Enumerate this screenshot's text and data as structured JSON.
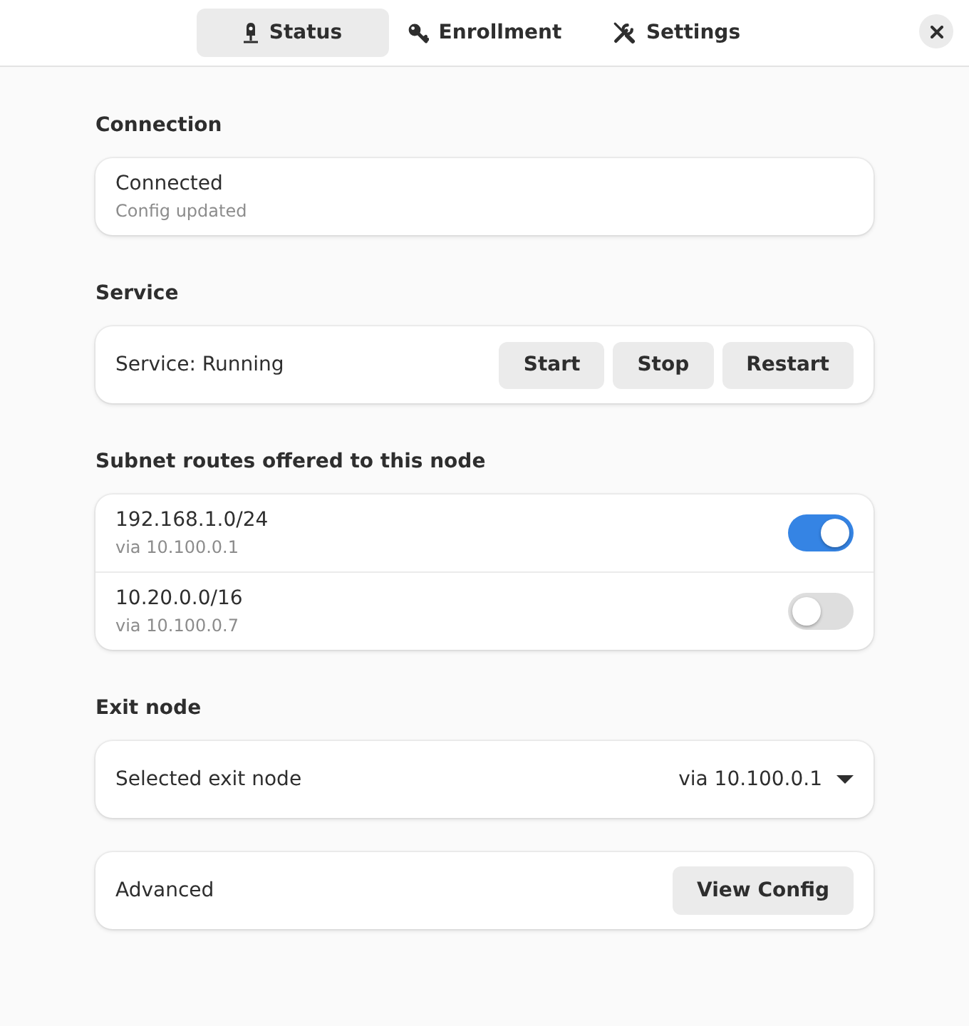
{
  "tabs": [
    {
      "label": "Status",
      "selected": true
    },
    {
      "label": "Enrollment",
      "selected": false
    },
    {
      "label": "Settings",
      "selected": false
    }
  ],
  "connection": {
    "heading": "Connection",
    "title": "Connected",
    "subtitle": "Config updated"
  },
  "service": {
    "heading": "Service",
    "label": "Service: Running",
    "buttons": [
      "Start",
      "Stop",
      "Restart"
    ]
  },
  "subnet_routes": {
    "heading": "Subnet routes offered to this node",
    "routes": [
      {
        "subnet": "192.168.1.0/24",
        "via": "via 10.100.0.1",
        "on": true
      },
      {
        "subnet": "10.20.0.0/16",
        "via": "via 10.100.0.7",
        "on": false
      }
    ]
  },
  "exit_node": {
    "heading": "Exit node",
    "label": "Selected exit node",
    "value": "via 10.100.0.1"
  },
  "advanced": {
    "label": "Advanced",
    "button": "View Config"
  }
}
